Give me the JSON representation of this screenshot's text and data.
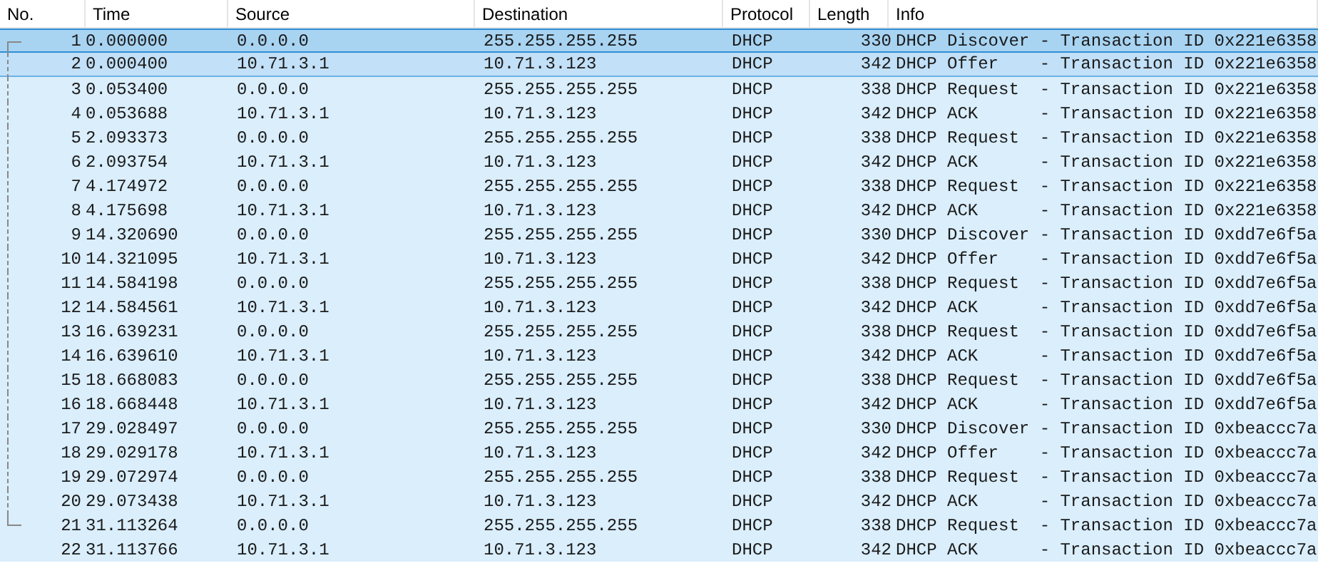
{
  "table": {
    "columns": [
      "No.",
      "Time",
      "Source",
      "Destination",
      "Protocol",
      "Length",
      "Info"
    ],
    "rows": [
      {
        "no": "1",
        "time": "0.000000",
        "source": "0.0.0.0",
        "destination": "255.255.255.255",
        "protocol": "DHCP",
        "length": "330",
        "info": "DHCP Discover - Transaction ID 0x221e6358",
        "selected": true,
        "related": false,
        "kind": "conversation_start"
      },
      {
        "no": "2",
        "time": "0.000400",
        "source": "10.71.3.1",
        "destination": "10.71.3.123",
        "protocol": "DHCP",
        "length": "342",
        "info": "DHCP Offer    - Transaction ID 0x221e6358",
        "selected": false,
        "related": true,
        "kind": "conversation_mid"
      },
      {
        "no": "3",
        "time": "0.053400",
        "source": "0.0.0.0",
        "destination": "255.255.255.255",
        "protocol": "DHCP",
        "length": "338",
        "info": "DHCP Request  - Transaction ID 0x221e6358",
        "selected": false,
        "related": false,
        "kind": "conversation_mid"
      },
      {
        "no": "4",
        "time": "0.053688",
        "source": "10.71.3.1",
        "destination": "10.71.3.123",
        "protocol": "DHCP",
        "length": "342",
        "info": "DHCP ACK      - Transaction ID 0x221e6358",
        "selected": false,
        "related": false,
        "kind": "conversation_mid"
      },
      {
        "no": "5",
        "time": "2.093373",
        "source": "0.0.0.0",
        "destination": "255.255.255.255",
        "protocol": "DHCP",
        "length": "338",
        "info": "DHCP Request  - Transaction ID 0x221e6358",
        "selected": false,
        "related": false,
        "kind": "conversation_mid"
      },
      {
        "no": "6",
        "time": "2.093754",
        "source": "10.71.3.1",
        "destination": "10.71.3.123",
        "protocol": "DHCP",
        "length": "342",
        "info": "DHCP ACK      - Transaction ID 0x221e6358",
        "selected": false,
        "related": false,
        "kind": "conversation_mid"
      },
      {
        "no": "7",
        "time": "4.174972",
        "source": "0.0.0.0",
        "destination": "255.255.255.255",
        "protocol": "DHCP",
        "length": "338",
        "info": "DHCP Request  - Transaction ID 0x221e6358",
        "selected": false,
        "related": false,
        "kind": "conversation_mid"
      },
      {
        "no": "8",
        "time": "4.175698",
        "source": "10.71.3.1",
        "destination": "10.71.3.123",
        "protocol": "DHCP",
        "length": "342",
        "info": "DHCP ACK      - Transaction ID 0x221e6358",
        "selected": false,
        "related": false,
        "kind": "conversation_mid"
      },
      {
        "no": "9",
        "time": "14.320690",
        "source": "0.0.0.0",
        "destination": "255.255.255.255",
        "protocol": "DHCP",
        "length": "330",
        "info": "DHCP Discover - Transaction ID 0xdd7e6f5a",
        "selected": false,
        "related": false,
        "kind": "conversation_mid"
      },
      {
        "no": "10",
        "time": "14.321095",
        "source": "10.71.3.1",
        "destination": "10.71.3.123",
        "protocol": "DHCP",
        "length": "342",
        "info": "DHCP Offer    - Transaction ID 0xdd7e6f5a",
        "selected": false,
        "related": false,
        "kind": "conversation_mid"
      },
      {
        "no": "11",
        "time": "14.584198",
        "source": "0.0.0.0",
        "destination": "255.255.255.255",
        "protocol": "DHCP",
        "length": "338",
        "info": "DHCP Request  - Transaction ID 0xdd7e6f5a",
        "selected": false,
        "related": false,
        "kind": "conversation_mid"
      },
      {
        "no": "12",
        "time": "14.584561",
        "source": "10.71.3.1",
        "destination": "10.71.3.123",
        "protocol": "DHCP",
        "length": "342",
        "info": "DHCP ACK      - Transaction ID 0xdd7e6f5a",
        "selected": false,
        "related": false,
        "kind": "conversation_mid"
      },
      {
        "no": "13",
        "time": "16.639231",
        "source": "0.0.0.0",
        "destination": "255.255.255.255",
        "protocol": "DHCP",
        "length": "338",
        "info": "DHCP Request  - Transaction ID 0xdd7e6f5a",
        "selected": false,
        "related": false,
        "kind": "conversation_mid"
      },
      {
        "no": "14",
        "time": "16.639610",
        "source": "10.71.3.1",
        "destination": "10.71.3.123",
        "protocol": "DHCP",
        "length": "342",
        "info": "DHCP ACK      - Transaction ID 0xdd7e6f5a",
        "selected": false,
        "related": false,
        "kind": "conversation_mid"
      },
      {
        "no": "15",
        "time": "18.668083",
        "source": "0.0.0.0",
        "destination": "255.255.255.255",
        "protocol": "DHCP",
        "length": "338",
        "info": "DHCP Request  - Transaction ID 0xdd7e6f5a",
        "selected": false,
        "related": false,
        "kind": "conversation_mid"
      },
      {
        "no": "16",
        "time": "18.668448",
        "source": "10.71.3.1",
        "destination": "10.71.3.123",
        "protocol": "DHCP",
        "length": "342",
        "info": "DHCP ACK      - Transaction ID 0xdd7e6f5a",
        "selected": false,
        "related": false,
        "kind": "conversation_mid"
      },
      {
        "no": "17",
        "time": "29.028497",
        "source": "0.0.0.0",
        "destination": "255.255.255.255",
        "protocol": "DHCP",
        "length": "330",
        "info": "DHCP Discover - Transaction ID 0xbeaccc7a",
        "selected": false,
        "related": false,
        "kind": "conversation_mid"
      },
      {
        "no": "18",
        "time": "29.029178",
        "source": "10.71.3.1",
        "destination": "10.71.3.123",
        "protocol": "DHCP",
        "length": "342",
        "info": "DHCP Offer    - Transaction ID 0xbeaccc7a",
        "selected": false,
        "related": false,
        "kind": "conversation_mid"
      },
      {
        "no": "19",
        "time": "29.072974",
        "source": "0.0.0.0",
        "destination": "255.255.255.255",
        "protocol": "DHCP",
        "length": "338",
        "info": "DHCP Request  - Transaction ID 0xbeaccc7a",
        "selected": false,
        "related": false,
        "kind": "conversation_mid"
      },
      {
        "no": "20",
        "time": "29.073438",
        "source": "10.71.3.1",
        "destination": "10.71.3.123",
        "protocol": "DHCP",
        "length": "342",
        "info": "DHCP ACK      - Transaction ID 0xbeaccc7a",
        "selected": false,
        "related": false,
        "kind": "conversation_mid"
      },
      {
        "no": "21",
        "time": "31.113264",
        "source": "0.0.0.0",
        "destination": "255.255.255.255",
        "protocol": "DHCP",
        "length": "338",
        "info": "DHCP Request  - Transaction ID 0xbeaccc7a",
        "selected": false,
        "related": false,
        "kind": "conversation_end"
      },
      {
        "no": "22",
        "time": "31.113766",
        "source": "10.71.3.1",
        "destination": "10.71.3.123",
        "protocol": "DHCP",
        "length": "342",
        "info": "DHCP ACK      - Transaction ID 0xbeaccc7a",
        "selected": false,
        "related": false,
        "kind": "plain"
      }
    ]
  }
}
